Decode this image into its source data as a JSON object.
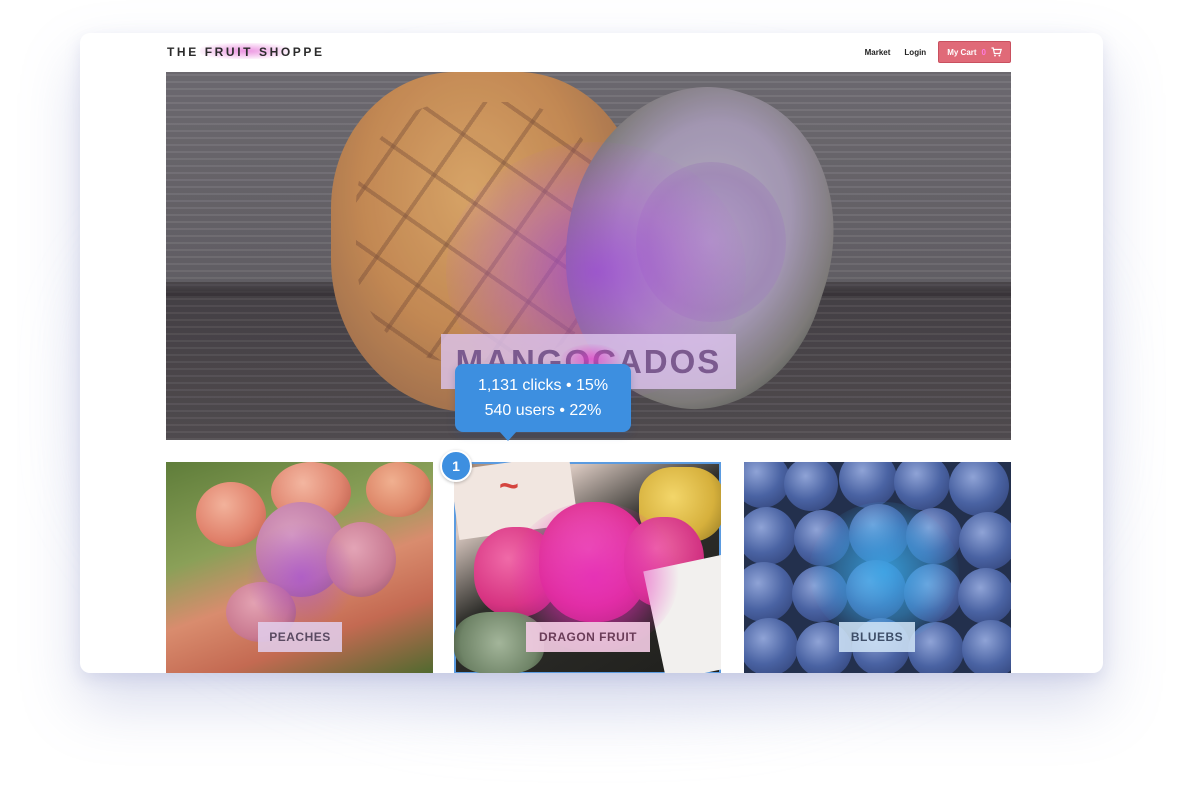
{
  "header": {
    "logo": "THE FRUIT SHOPPE",
    "nav": [
      "Market",
      "Login"
    ],
    "cart": {
      "label": "My Cart",
      "count": "0",
      "icon": "cart-icon"
    }
  },
  "hero": {
    "title": "MANGOCADOS"
  },
  "tooltip": {
    "line1": "1,131 clicks • 15%",
    "line2": "540 users • 22%"
  },
  "marker": {
    "number": "1"
  },
  "cards": [
    {
      "label": "PEACHES"
    },
    {
      "label": "DRAGON FRUIT"
    },
    {
      "label": "BLUEBS"
    }
  ],
  "colors": {
    "accent": "#3d8fe0",
    "cart_button": "#e06a78",
    "heat_magenta": "#d62ac8",
    "heat_purple": "#a046dc",
    "heat_blue": "#3a9ee0"
  }
}
